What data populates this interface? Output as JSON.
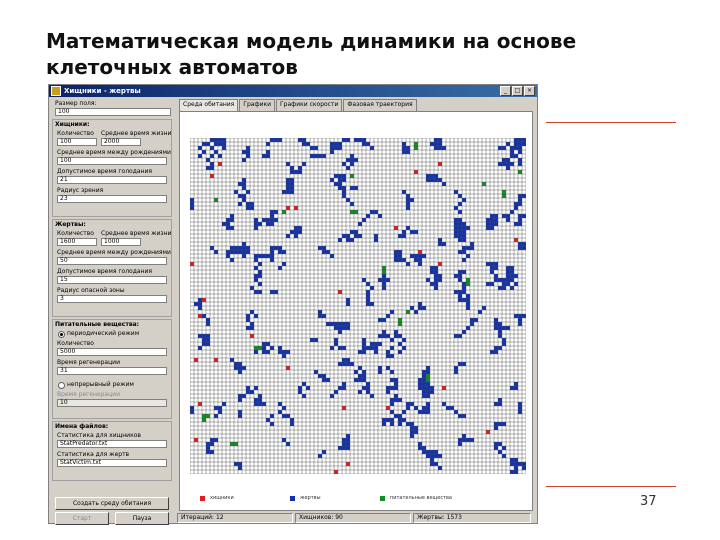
{
  "slide": {
    "title": "Математическая модель динамики на основе клеточных автоматов",
    "number": "37",
    "accent_color": "#d04030"
  },
  "window": {
    "title": "Хищники - жертвы",
    "min_label": "_",
    "max_label": "□",
    "close_label": "×"
  },
  "params": {
    "field_size_label": "Размер поля:",
    "field_size_value": "100",
    "predators": {
      "header": "Хищники:",
      "count_label": "Количество",
      "avg_life_label": "Среднее время жизни",
      "count": "100",
      "avg_life": "2000",
      "birth_interval_label": "Среднее время между рождениями",
      "birth_interval": "100",
      "hunger_label": "Допустимое время голодания",
      "hunger": "21",
      "view_radius_label": "Радиус зрения",
      "view_radius": "23"
    },
    "prey": {
      "header": "Жертвы:",
      "count_label": "Количество",
      "avg_life_label": "Среднее время жизни",
      "count": "1600",
      "avg_life": "1000",
      "birth_interval_label": "Среднее время между рождениями",
      "birth_interval": "50",
      "hunger_label": "Допустимое время голодания",
      "hunger": "15",
      "danger_radius_label": "Радиус опасной зоны",
      "danger_radius": "3"
    },
    "food": {
      "header": "Питательные вещества:",
      "periodic_label": "периодический режим",
      "amount_label": "Количество",
      "amount": "5000",
      "regen_label": "Время регенерации",
      "regen": "31",
      "continuous_label": "непрерывный режим",
      "growth_label": "Время регенерации",
      "growth": "10"
    },
    "files": {
      "header": "Имена файлов:",
      "predators_label": "Статистика для хищников",
      "predators_file": "StatPredator.txt",
      "prey_label": "Статистика для жертв",
      "prey_file": "StatVictim.txt"
    },
    "create_button": "Создать среду обитания",
    "start_button": "Старт",
    "pause_button": "Пауза"
  },
  "tabs": [
    "Среда обитания",
    "Графики",
    "Графики скорости",
    "Фазовая траектория"
  ],
  "legend": [
    {
      "label": "хищники",
      "color": "#e02020"
    },
    {
      "label": "жертвы",
      "color": "#1030b0"
    },
    {
      "label": "питательные вещества",
      "color": "#109020"
    }
  ],
  "status": {
    "iterations": "Итераций: 12",
    "predators": "Хищников: 90",
    "prey": "Жертвы: 1573"
  }
}
